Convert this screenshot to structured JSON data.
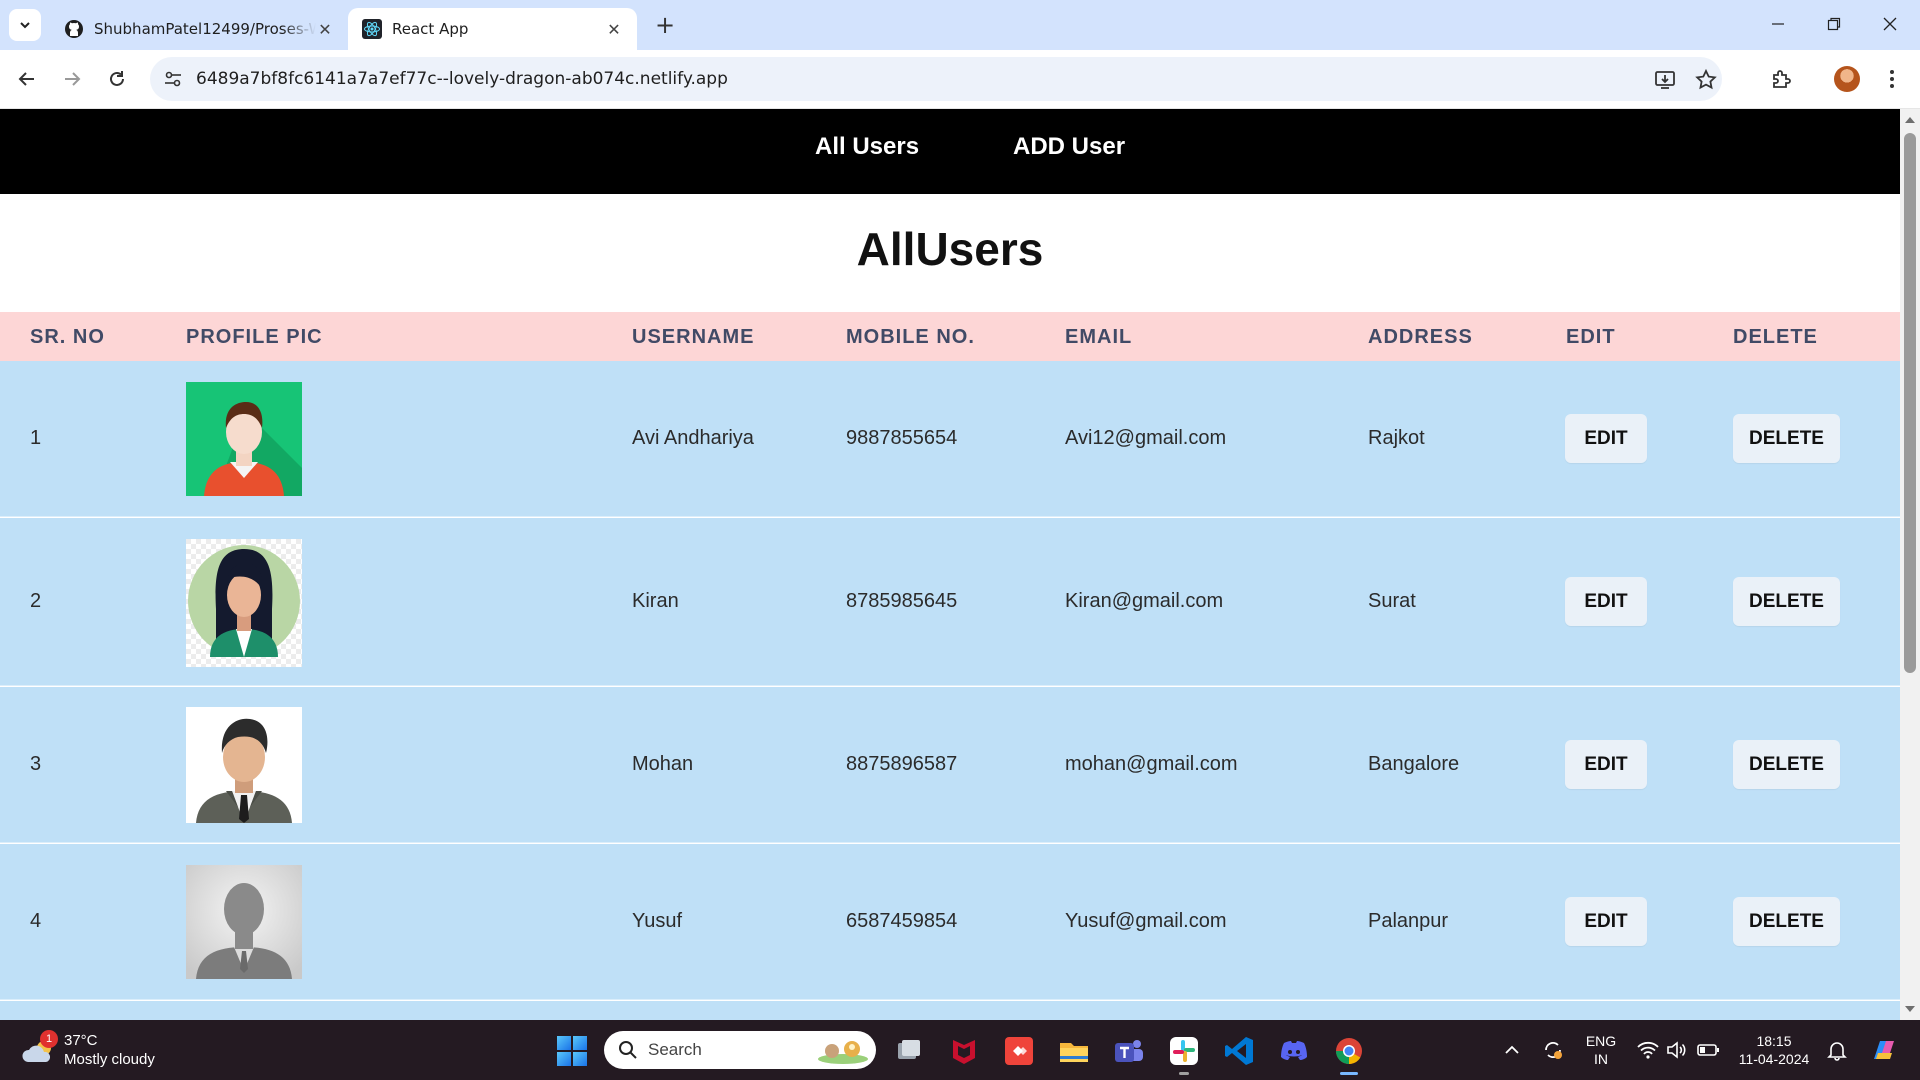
{
  "browser": {
    "tabs": [
      {
        "title": "ShubhamPatel12499/Proses-Web",
        "favicon": "github-icon",
        "active": false
      },
      {
        "title": "React App",
        "favicon": "react-icon",
        "active": true
      }
    ],
    "url": "6489a7bf8fc6141a7a7ef77c--lovely-dragon-ab074c.netlify.app"
  },
  "app": {
    "nav": {
      "all_users": "All Users",
      "add_user": "ADD User"
    },
    "heading": "AllUsers",
    "columns": {
      "sr_no": "SR. NO",
      "profile_pic": "PROFILE PIC",
      "username": "USERNAME",
      "mobile": "MOBILE NO.",
      "email": "EMAIL",
      "address": "ADDRESS",
      "edit": "EDIT",
      "delete": "DELETE"
    },
    "users": [
      {
        "sr": "1",
        "username": "Avi Andhariya",
        "mobile": "9887855654",
        "email": "Avi12@gmail.com",
        "address": "Rajkot",
        "avatar": "avatar-man-green-background"
      },
      {
        "sr": "2",
        "username": "Kiran",
        "mobile": "8785985645",
        "email": "Kiran@gmail.com",
        "address": "Surat",
        "avatar": "avatar-woman-green-circle"
      },
      {
        "sr": "3",
        "username": "Mohan",
        "mobile": "8875896587",
        "email": "mohan@gmail.com",
        "address": "Bangalore",
        "avatar": "avatar-man-suit"
      },
      {
        "sr": "4",
        "username": "Yusuf",
        "mobile": "6587459854",
        "email": "Yusuf@gmail.com",
        "address": "Palanpur",
        "avatar": "avatar-silhouette-grey"
      }
    ],
    "edit_label": "EDIT",
    "delete_label": "DELETE"
  },
  "taskbar": {
    "weather": {
      "temp": "37°C",
      "condition": "Mostly cloudy",
      "badge": "1"
    },
    "search_placeholder": "Search",
    "lang": {
      "line1": "ENG",
      "line2": "IN"
    },
    "time": "18:15",
    "date": "11-04-2024"
  },
  "colors": {
    "nav_bg": "#000000",
    "table_header_bg": "#fdd6d6",
    "row_bg": "#bfe0f7",
    "button_bg": "#eaf1f8",
    "tabstrip_bg": "#d3e3fd"
  }
}
